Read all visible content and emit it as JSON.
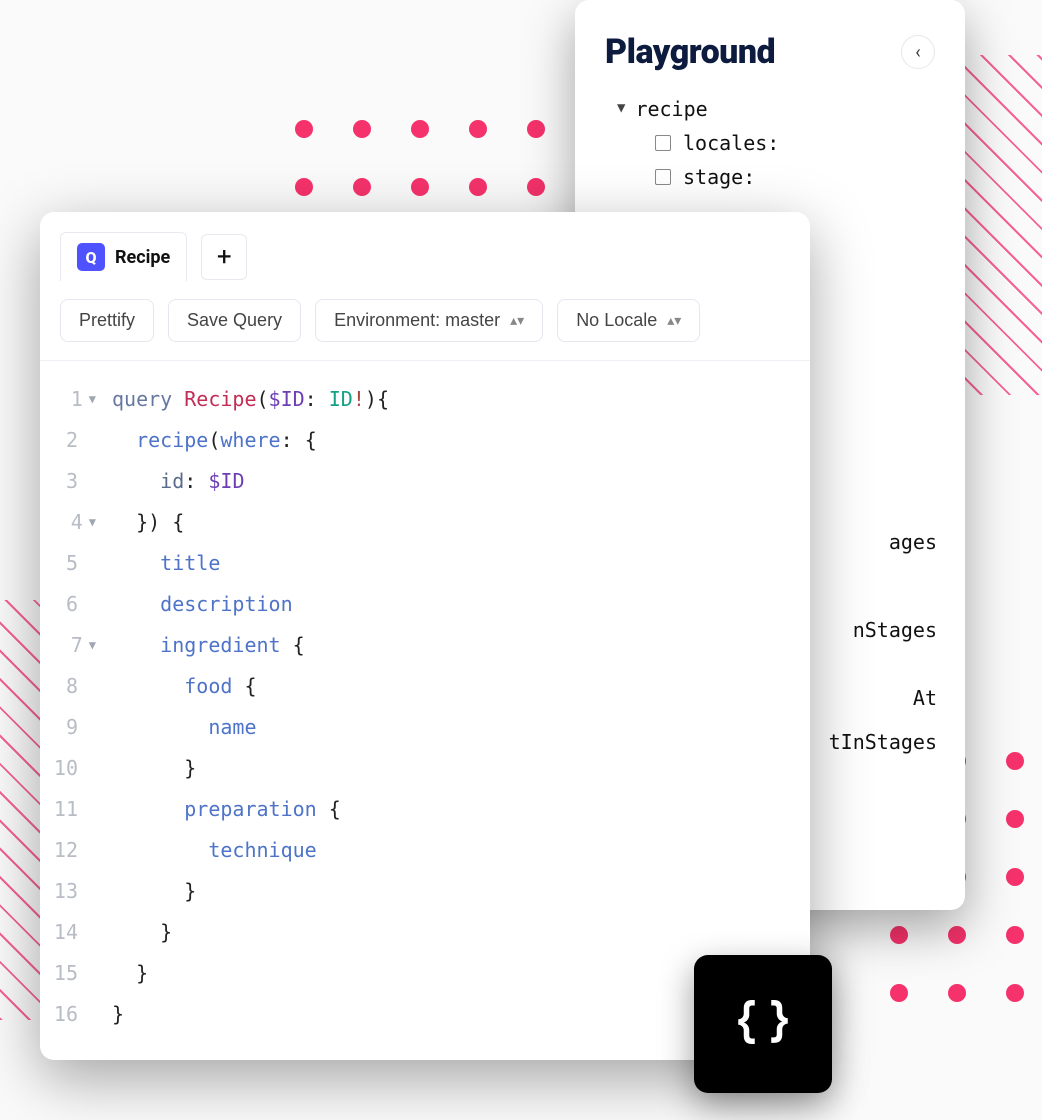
{
  "playground": {
    "title": "Playground",
    "tree": {
      "root": "recipe",
      "args": [
        "locales:",
        "stage:"
      ]
    },
    "peek_lines": [
      "ages",
      "nStages",
      "At",
      "tInStages"
    ]
  },
  "editor": {
    "tab_badge": "Q",
    "tab_label": "Recipe",
    "toolbar": {
      "prettify": "Prettify",
      "save": "Save Query",
      "environment": "Environment: master",
      "locale": "No Locale"
    },
    "code_lines": [
      {
        "n": 1,
        "fold": true,
        "tokens": [
          [
            "kw",
            "query "
          ],
          [
            "name",
            "Recipe"
          ],
          [
            "punc",
            "("
          ],
          [
            "var",
            "$ID"
          ],
          [
            "punc",
            ": "
          ],
          [
            "type",
            "ID"
          ],
          [
            "bang",
            "!"
          ],
          [
            "punc",
            "){"
          ]
        ]
      },
      {
        "n": 2,
        "fold": false,
        "tokens": [
          [
            "pad",
            "  "
          ],
          [
            "field",
            "recipe"
          ],
          [
            "punc",
            "("
          ],
          [
            "arg",
            "where"
          ],
          [
            "punc",
            ": {"
          ]
        ]
      },
      {
        "n": 3,
        "fold": false,
        "tokens": [
          [
            "pad",
            "    "
          ],
          [
            "argk",
            "id"
          ],
          [
            "punc",
            ": "
          ],
          [
            "var",
            "$ID"
          ]
        ]
      },
      {
        "n": 4,
        "fold": true,
        "tokens": [
          [
            "pad",
            "  "
          ],
          [
            "punc",
            "}) {"
          ]
        ]
      },
      {
        "n": 5,
        "fold": false,
        "tokens": [
          [
            "pad",
            "    "
          ],
          [
            "field",
            "title"
          ]
        ]
      },
      {
        "n": 6,
        "fold": false,
        "tokens": [
          [
            "pad",
            "    "
          ],
          [
            "field",
            "description"
          ]
        ]
      },
      {
        "n": 7,
        "fold": true,
        "tokens": [
          [
            "pad",
            "    "
          ],
          [
            "field",
            "ingredient"
          ],
          [
            "punc",
            " {"
          ]
        ]
      },
      {
        "n": 8,
        "fold": false,
        "tokens": [
          [
            "pad",
            "      "
          ],
          [
            "field",
            "food"
          ],
          [
            "punc",
            " {"
          ]
        ]
      },
      {
        "n": 9,
        "fold": false,
        "tokens": [
          [
            "pad",
            "        "
          ],
          [
            "field",
            "name"
          ]
        ]
      },
      {
        "n": 10,
        "fold": false,
        "tokens": [
          [
            "pad",
            "      "
          ],
          [
            "punc",
            "}"
          ]
        ]
      },
      {
        "n": 11,
        "fold": false,
        "tokens": [
          [
            "pad",
            "      "
          ],
          [
            "field",
            "preparation"
          ],
          [
            "punc",
            " {"
          ]
        ]
      },
      {
        "n": 12,
        "fold": false,
        "tokens": [
          [
            "pad",
            "        "
          ],
          [
            "field",
            "technique"
          ]
        ]
      },
      {
        "n": 13,
        "fold": false,
        "tokens": [
          [
            "pad",
            "      "
          ],
          [
            "punc",
            "}"
          ]
        ]
      },
      {
        "n": 14,
        "fold": false,
        "tokens": [
          [
            "pad",
            "    "
          ],
          [
            "punc",
            "}"
          ]
        ]
      },
      {
        "n": 15,
        "fold": false,
        "tokens": [
          [
            "pad",
            "  "
          ],
          [
            "punc",
            "}"
          ]
        ]
      },
      {
        "n": 16,
        "fold": false,
        "tokens": [
          [
            "punc",
            "}"
          ]
        ]
      }
    ]
  }
}
